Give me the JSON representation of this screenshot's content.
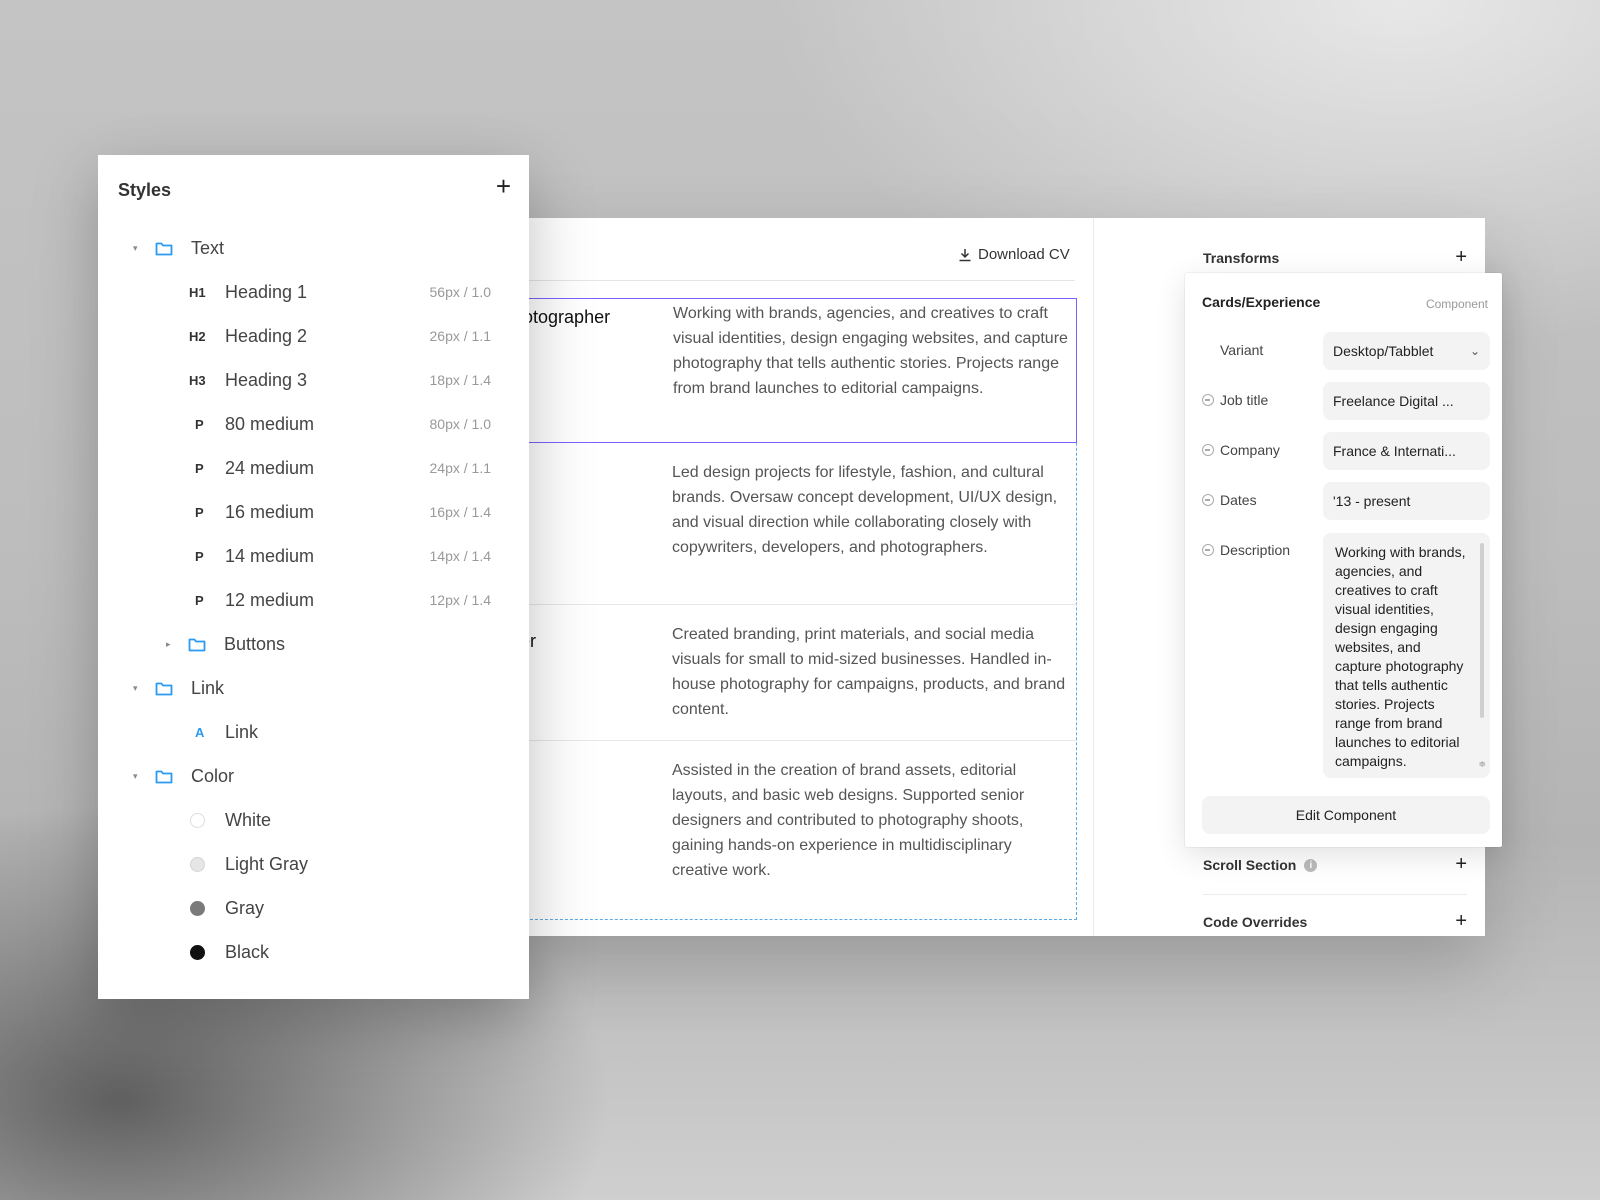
{
  "styles_panel": {
    "title": "Styles",
    "add_label": "+",
    "groups": {
      "text": {
        "label": "Text",
        "items": [
          {
            "tag": "H1",
            "label": "Heading 1",
            "meta": "56px / 1.0"
          },
          {
            "tag": "H2",
            "label": "Heading 2",
            "meta": "26px / 1.1"
          },
          {
            "tag": "H3",
            "label": "Heading 3",
            "meta": "18px / 1.4"
          },
          {
            "tag": "P",
            "label": "80 medium",
            "meta": "80px / 1.0"
          },
          {
            "tag": "P",
            "label": "24 medium",
            "meta": "24px / 1.1"
          },
          {
            "tag": "P",
            "label": "16 medium",
            "meta": "16px / 1.4"
          },
          {
            "tag": "P",
            "label": "14 medium",
            "meta": "14px / 1.4"
          },
          {
            "tag": "P",
            "label": "12 medium",
            "meta": "12px / 1.4"
          }
        ]
      },
      "buttons": {
        "label": "Buttons"
      },
      "link": {
        "label": "Link",
        "items": [
          {
            "tag": "A",
            "label": "Link"
          }
        ]
      },
      "color": {
        "label": "Color",
        "items": [
          {
            "label": "White",
            "hex": "#ffffff"
          },
          {
            "label": "Light Gray",
            "hex": "#e6e6e6"
          },
          {
            "label": "Gray",
            "hex": "#7a7a7a"
          },
          {
            "label": "Black",
            "hex": "#111111"
          }
        ]
      }
    }
  },
  "canvas": {
    "download_label": "Download CV",
    "experience": [
      {
        "role": "Photographer",
        "description": "Working with brands, agencies, and creatives to craft visual identities, design engaging websites, and capture photography that tells authentic stories. Projects range from brand launches to editorial campaigns."
      },
      {
        "role": "",
        "description": "Led design projects for lifestyle, fashion, and cultural brands. Oversaw concept development, UI/UX design, and visual direction while collaborating closely with copywriters, developers, and photographers."
      },
      {
        "role": "er",
        "description": "Created branding, print materials, and social media visuals for small to mid-sized businesses. Handled in-house photography for campaigns, products, and brand content."
      },
      {
        "role": "",
        "description": "Assisted in the creation of brand assets, editorial layouts, and basic web designs. Supported senior designers and contributed to photography shoots, gaining hands-on experience in multidisciplinary creative work."
      }
    ]
  },
  "properties": {
    "transforms": "Transforms",
    "scroll_section": "Scroll Section",
    "code_overrides": "Code Overrides",
    "add_label": "+"
  },
  "component": {
    "title": "Cards/Experience",
    "tag": "Component",
    "variant_label": "Variant",
    "variant_value": "Desktop/Tabblet",
    "job_title_label": "Job title",
    "job_title_value": "Freelance Digital ...",
    "company_label": "Company",
    "company_value": "France & Internati...",
    "dates_label": "Dates",
    "dates_value": "'13 - present",
    "description_label": "Description",
    "description_value": "Working with brands, agencies, and creatives to craft visual identities, design engaging websites, and capture photography that tells authentic stories. Projects range from brand launches to editorial campaigns.",
    "edit_button": "Edit Component"
  },
  "colors": {
    "selection": "#7b61ff",
    "dashed": "#5aa9ea",
    "folder": "#2b9af3"
  }
}
